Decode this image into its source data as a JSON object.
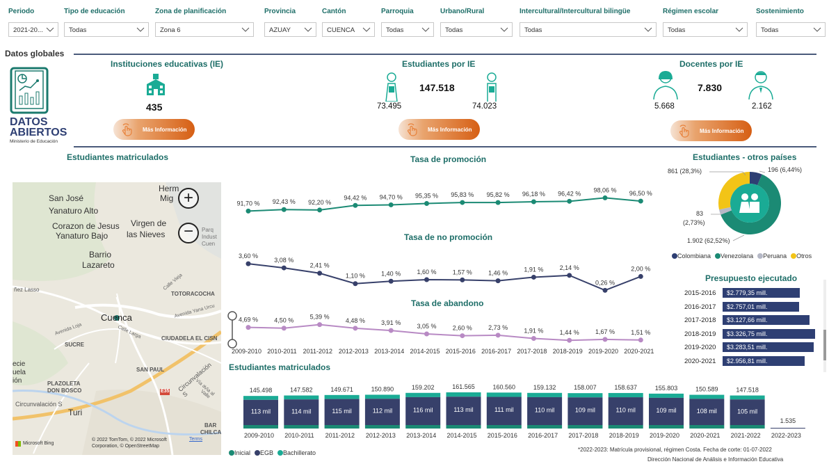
{
  "filters": [
    {
      "label": "Periodo",
      "value": "2021-20..."
    },
    {
      "label": "Tipo de educación",
      "value": "Todas"
    },
    {
      "label": "Zona de planificación",
      "value": "Zona 6"
    },
    {
      "label": "Provincia",
      "value": "AZUAY"
    },
    {
      "label": "Cantón",
      "value": "CUENCA"
    },
    {
      "label": "Parroquia",
      "value": "Todas"
    },
    {
      "label": "Urbano/Rural",
      "value": "Todas"
    },
    {
      "label": "Intercultural/Intercultural bilingüe",
      "value": "Todas"
    },
    {
      "label": "Régimen escolar",
      "value": "Todas"
    },
    {
      "label": "Sostenimiento",
      "value": "Todas"
    }
  ],
  "globals": {
    "title": "Datos globales"
  },
  "logo": {
    "line1": "DATOS",
    "line2": "ABIERTOS",
    "sub": "Ministerio de Educación"
  },
  "kpi": {
    "ie": {
      "title": "Instituciones educativas (IE)",
      "value": "435",
      "button": "Más Información"
    },
    "students": {
      "title": "Estudiantes  por IE",
      "total": "147.518",
      "female": "73.495",
      "male": "74.023",
      "button": "Más Información"
    },
    "teachers": {
      "title": "Docentes por IE",
      "total": "7.830",
      "female": "5.668",
      "male": "2.162",
      "button": "Más Información"
    }
  },
  "map": {
    "title": "Estudiantes matriculados",
    "labels": [
      "San José",
      "Yanaturo Alto",
      "Corazon de Jesus",
      "Virgen de",
      "las Nieves",
      "Yanaturo Bajo",
      "Barrio",
      "Lazareto",
      "Cuenca",
      "SUCRE",
      "SAN PAUL",
      "PLAZOLETA",
      "DON BOSCO",
      "Turi",
      "Herm",
      "Mig",
      "TOTORACOCHA",
      "CIUDADELA EL CISN",
      "Circunvalación S",
      "Circunvalación S",
      "Parq",
      "Indust",
      "Cuen",
      "ñez Lasso",
      "Avenida Loja",
      "Calle Larga",
      "Avenida Yana Urcu",
      "Calle Vieja",
      "Via al Valle",
      "Vía a",
      "BAR",
      "CHILCAP",
      "ecie",
      "uela",
      "ión",
      "E35"
    ],
    "attribution": "© 2022 TomTom, © 2022 Microsoft Corporation, © OpenStreetMap",
    "terms": "Terms",
    "bing": "Microsoft Bing"
  },
  "years": [
    "2009-2010",
    "2010-2011",
    "2011-2012",
    "2012-2013",
    "2013-2014",
    "2014-2015",
    "2015-2016",
    "2016-2017",
    "2017-2018",
    "2018-2019",
    "2019-2020",
    "2020-2021"
  ],
  "promo": {
    "title": "Tasa de promoción",
    "values": [
      91.7,
      92.43,
      92.2,
      94.42,
      94.7,
      95.35,
      95.83,
      95.82,
      96.18,
      96.42,
      98.06,
      96.5
    ],
    "labels": [
      "91,70 %",
      "92,43 %",
      "92,20 %",
      "94,42 %",
      "94,70 %",
      "95,35 %",
      "95,83 %",
      "95,82 %",
      "96,18 %",
      "96,42 %",
      "98,06 %",
      "96,50 %"
    ],
    "color": "#1b8a74"
  },
  "nopromo": {
    "title": "Tasa de no promoción",
    "values": [
      3.6,
      3.08,
      2.41,
      1.1,
      1.4,
      1.6,
      1.57,
      1.46,
      1.91,
      2.14,
      0.26,
      2.0
    ],
    "labels": [
      "3,60 %",
      "3,08 %",
      "2,41 %",
      "1,10 %",
      "1,40 %",
      "1,60 %",
      "1,57 %",
      "1,46 %",
      "1,91 %",
      "2,14 %",
      "0,26 %",
      "2,00 %"
    ],
    "color": "#37406a"
  },
  "aband": {
    "title": "Tasa de abandono",
    "values": [
      4.69,
      4.5,
      5.39,
      4.48,
      3.91,
      3.05,
      2.6,
      2.73,
      1.91,
      1.44,
      1.67,
      1.51
    ],
    "labels": [
      "4,69 %",
      "4,50 %",
      "5,39 %",
      "4,48 %",
      "3,91 %",
      "3,05 %",
      "2,60 %",
      "2,73 %",
      "1,91 %",
      "1,44 %",
      "1,67 %",
      "1,51 %"
    ],
    "color": "#b88ac4"
  },
  "donut": {
    "title": "Estudiantes - otros países",
    "slices": [
      {
        "name": "Colombiana",
        "value": 196,
        "label": "196 (6,44%)",
        "color": "#2e3f73"
      },
      {
        "name": "Venezolana",
        "value": 1902,
        "label": "1.902 (62,52%)",
        "color": "#1b8a74"
      },
      {
        "name": "Peruana",
        "value": 83,
        "label": "83",
        "label2": "(2,73%)",
        "color": "#b5b8c6"
      },
      {
        "name": "Otros",
        "value": 861,
        "label": "861 (28,3%)",
        "color": "#f2c417"
      }
    ]
  },
  "budget": {
    "title": "Presupuesto ejecutado",
    "rows": [
      {
        "year": "2015-2016",
        "value": 2779.35,
        "label": "$2.779,35 mill."
      },
      {
        "year": "2016-2017",
        "value": 2757.01,
        "label": "$2.757,01 mill."
      },
      {
        "year": "2017-2018",
        "value": 3127.66,
        "label": "$3.127,66 mill."
      },
      {
        "year": "2018-2019",
        "value": 3326.75,
        "label": "$3.326,75 mill."
      },
      {
        "year": "2019-2020",
        "value": 3283.51,
        "label": "$3.283,51 mill."
      },
      {
        "year": "2020-2021",
        "value": 2956.81,
        "label": "$2.956,81 mill."
      }
    ]
  },
  "chart_data": [
    {
      "type": "line",
      "title": "Tasa de promoción",
      "categories": [
        "2009-2010",
        "2010-2011",
        "2011-2012",
        "2012-2013",
        "2013-2014",
        "2014-2015",
        "2015-2016",
        "2016-2017",
        "2017-2018",
        "2018-2019",
        "2019-2020",
        "2020-2021"
      ],
      "values": [
        91.7,
        92.43,
        92.2,
        94.42,
        94.7,
        95.35,
        95.83,
        95.82,
        96.18,
        96.42,
        98.06,
        96.5
      ]
    },
    {
      "type": "line",
      "title": "Tasa de no promoción",
      "categories": [
        "2009-2010",
        "2010-2011",
        "2011-2012",
        "2012-2013",
        "2013-2014",
        "2014-2015",
        "2015-2016",
        "2016-2017",
        "2017-2018",
        "2018-2019",
        "2019-2020",
        "2020-2021"
      ],
      "values": [
        3.6,
        3.08,
        2.41,
        1.1,
        1.4,
        1.6,
        1.57,
        1.46,
        1.91,
        2.14,
        0.26,
        2.0
      ]
    },
    {
      "type": "line",
      "title": "Tasa de abandono",
      "categories": [
        "2009-2010",
        "2010-2011",
        "2011-2012",
        "2012-2013",
        "2013-2014",
        "2014-2015",
        "2015-2016",
        "2016-2017",
        "2017-2018",
        "2018-2019",
        "2019-2020",
        "2020-2021"
      ],
      "values": [
        4.69,
        4.5,
        5.39,
        4.48,
        3.91,
        3.05,
        2.6,
        2.73,
        1.91,
        1.44,
        1.67,
        1.51
      ]
    },
    {
      "type": "bar",
      "title": "Estudiantes matriculados",
      "categories": [
        "2009-2010",
        "2010-2011",
        "2011-2012",
        "2012-2013",
        "2013-2014",
        "2014-2015",
        "2015-2016",
        "2016-2017",
        "2017-2018",
        "2018-2019",
        "2019-2020",
        "2020-2021",
        "2021-2022",
        "2022-2023"
      ],
      "totals": [
        "145.498",
        "147.582",
        "149.671",
        "150.890",
        "159.202",
        "161.565",
        "160.560",
        "159.132",
        "158.007",
        "158.637",
        "155.803",
        "150.589",
        "147.518",
        "1.535"
      ],
      "total_values": [
        145498,
        147582,
        149671,
        150890,
        159202,
        161565,
        160560,
        159132,
        158007,
        158637,
        155803,
        150589,
        147518,
        1535
      ],
      "egb_labels": [
        "113 mil",
        "114 mil",
        "115 mil",
        "112 mil",
        "116 mil",
        "113 mil",
        "111 mil",
        "110 mil",
        "109 mil",
        "110 mil",
        "109 mil",
        "108 mil",
        "105 mil",
        ""
      ],
      "series": [
        {
          "name": "Inicial",
          "color": "#1b8a74"
        },
        {
          "name": "EGB",
          "color": "#37406a"
        },
        {
          "name": "Bachillerato",
          "color": "#1aab95"
        }
      ]
    },
    {
      "type": "pie",
      "title": "Estudiantes - otros países",
      "categories": [
        "Colombiana",
        "Venezolana",
        "Peruana",
        "Otros"
      ],
      "values": [
        196,
        1902,
        83,
        861
      ]
    },
    {
      "type": "bar",
      "title": "Presupuesto ejecutado",
      "categories": [
        "2015-2016",
        "2016-2017",
        "2017-2018",
        "2018-2019",
        "2019-2020",
        "2020-2021"
      ],
      "values": [
        2779.35,
        2757.01,
        3127.66,
        3326.75,
        3283.51,
        2956.81
      ]
    }
  ],
  "matric": {
    "title": "Estudiantes matriculados",
    "legend": [
      {
        "name": "Inicial",
        "color": "#1b8a74"
      },
      {
        "name": "EGB",
        "color": "#37406a"
      },
      {
        "name": "Bachillerato",
        "color": "#1aab95"
      }
    ]
  },
  "footer": {
    "note": "*2022-2023: Matrícula provisional, régimen Costa. Fecha de corte: 01-07-2022",
    "source": "Dirección Nacional de Análisis e Información Educativa"
  }
}
